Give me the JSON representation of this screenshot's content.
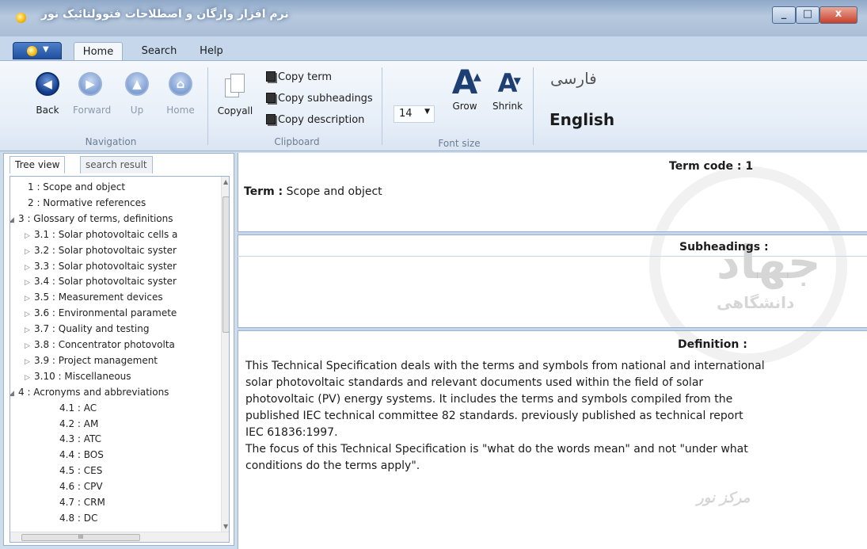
{
  "window": {
    "title": "نرم افزار وازگان و اصطلاحات فتوولتائیک نور",
    "controls": {
      "minimize": "_",
      "maximize": "□",
      "close": "x"
    }
  },
  "ribbon": {
    "tabs": [
      {
        "label": "Home",
        "active": true
      },
      {
        "label": "Search",
        "active": false
      },
      {
        "label": "Help",
        "active": false
      }
    ],
    "navigation": {
      "group_label": "Navigation",
      "back": "Back",
      "forward": "Forward",
      "up": "Up",
      "home": "Home"
    },
    "clipboard": {
      "group_label": "Clipboard",
      "copyall": "Copyall",
      "copy_term": "Copy term",
      "copy_subheadings": "Copy subheadings",
      "copy_description": "Copy description"
    },
    "font_size": {
      "group_label": "Font size",
      "value": "14",
      "grow": "Grow",
      "shrink": "Shrink"
    },
    "language": {
      "farsi": "فارسی",
      "english": "English"
    }
  },
  "left_panel": {
    "tabs": [
      "Tree view",
      "search result"
    ],
    "tree": [
      {
        "label": "1 : Scope and object",
        "level": 0,
        "expander": ""
      },
      {
        "label": "2 : Normative references",
        "level": 0,
        "expander": ""
      },
      {
        "label": "3 : Glossary of terms, definitions",
        "level": 0,
        "expander": "◢"
      },
      {
        "label": "3.1 : Solar photovoltaic cells a",
        "level": 1,
        "expander": "▷"
      },
      {
        "label": "3.2 : Solar photovoltaic syster",
        "level": 1,
        "expander": "▷"
      },
      {
        "label": "3.3 : Solar photovoltaic syster",
        "level": 1,
        "expander": "▷"
      },
      {
        "label": "3.4 : Solar photovoltaic syster",
        "level": 1,
        "expander": "▷"
      },
      {
        "label": "3.5 : Measurement devices",
        "level": 1,
        "expander": "▷"
      },
      {
        "label": "3.6 : Environmental paramete",
        "level": 1,
        "expander": "▷"
      },
      {
        "label": "3.7 : Quality and testing",
        "level": 1,
        "expander": "▷"
      },
      {
        "label": "3.8 : Concentrator photovolta",
        "level": 1,
        "expander": "▷"
      },
      {
        "label": "3.9 : Project management",
        "level": 1,
        "expander": "▷"
      },
      {
        "label": "3.10 : Miscellaneous",
        "level": 1,
        "expander": "▷"
      },
      {
        "label": "4 : Acronyms and abbreviations",
        "level": 0,
        "expander": "◢"
      },
      {
        "label": "4.1 : AC",
        "level": 2,
        "expander": ""
      },
      {
        "label": "4.2 : AM",
        "level": 2,
        "expander": ""
      },
      {
        "label": "4.3 : ATC",
        "level": 2,
        "expander": ""
      },
      {
        "label": "4.4 : BOS",
        "level": 2,
        "expander": ""
      },
      {
        "label": "4.5 : CES",
        "level": 2,
        "expander": ""
      },
      {
        "label": "4.6 : CPV",
        "level": 2,
        "expander": ""
      },
      {
        "label": "4.7 : CRM",
        "level": 2,
        "expander": ""
      },
      {
        "label": "4.8 : DC",
        "level": 2,
        "expander": ""
      }
    ],
    "hscroll_grip": "III"
  },
  "content": {
    "term_code_label": "Term code : 1",
    "term_label": "Term :",
    "term_value": "Scope and object",
    "subheadings_label": "Subheadings :",
    "definition_label": "Definition :",
    "definition_text": "This Technical Specification deals with the terms and symbols from national and international\nsolar photovoltaic standards and relevant documents used within the field of solar\nphotovoltaic (PV) energy systems. It includes the terms and symbols compiled from the\npublished IEC technical committee 82 standards. previously published as technical report\nIEC 61836:1997.\nThe focus of this Technical Specification is \"what do the words mean\" and not \"under what\nconditions do the terms apply\"."
  },
  "watermark": {
    "line1": "جهاد",
    "line2": "دانشگاهی",
    "line3": "مرکز نور"
  }
}
